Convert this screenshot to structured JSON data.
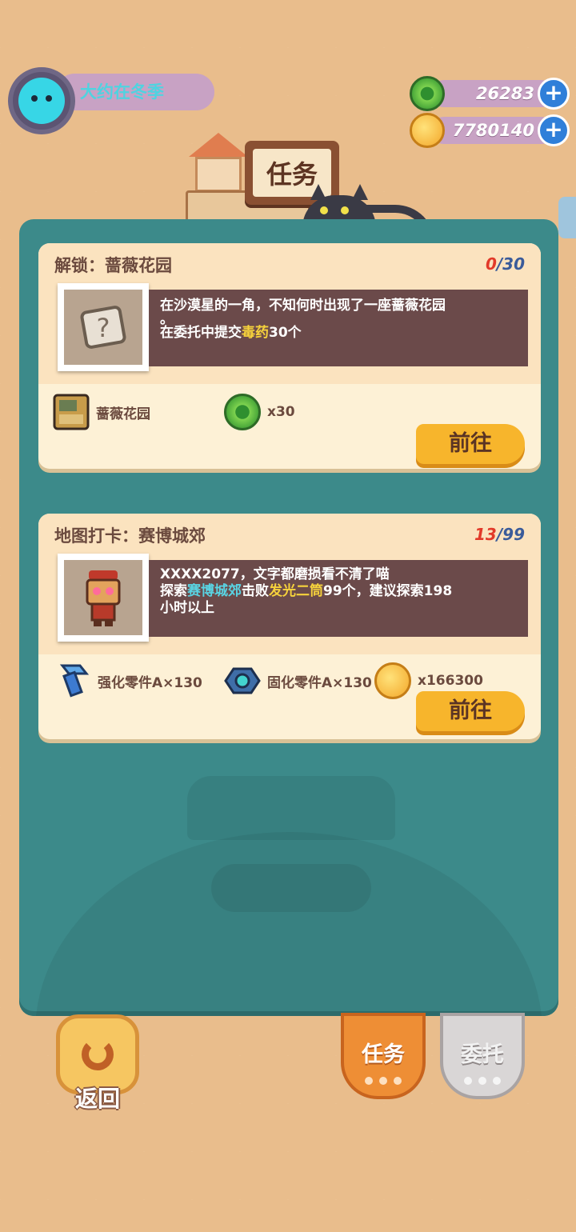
{
  "player": {
    "name": "大约在冬季"
  },
  "currency": [
    {
      "icon": "green-coin-icon",
      "value": "26283"
    },
    {
      "icon": "gold-coin-icon",
      "value": "7780140"
    }
  ],
  "header": {
    "title": "任务"
  },
  "quests": [
    {
      "title": "解锁：蔷薇花园",
      "progress_current": "0",
      "progress_total": "/30",
      "image_icon": "unknown-map-icon",
      "desc_line1": "在沙漠星的一角，不知何时出现了一座蔷薇花园",
      "desc_line2_prefix": "。",
      "desc_line3_prefix": "在委托中提交",
      "desc_highlight1": "毒药",
      "desc_line3_suffix": "30个",
      "rewards": [
        {
          "icon": "garden-map-icon",
          "label": "蔷薇花园"
        },
        {
          "icon": "green-coin-icon",
          "label": "x30"
        }
      ],
      "button": "前往"
    },
    {
      "title": "地图打卡：赛博城郊",
      "progress_current": "13",
      "progress_total": "/99",
      "image_icon": "robot-icon",
      "desc_line1": "XXXX2077，文字都磨损看不清了喵",
      "desc_line2_prefix": "探索",
      "desc_highlight_cyan": "赛博城郊",
      "desc_mid": "击败",
      "desc_highlight_yellow": "发光二筒",
      "desc_line2_suffix": "99个，建议探索198",
      "desc_line3": "小时以上",
      "rewards": [
        {
          "icon": "bolt-icon",
          "label": "强化零件A×130"
        },
        {
          "icon": "hex-nut-icon",
          "label": "固化零件A×130"
        },
        {
          "icon": "gold-coin-icon",
          "label": "x166300"
        }
      ],
      "button": "前往"
    }
  ],
  "bottom": {
    "back_label": "返回",
    "tab_task": "任务",
    "tab_entrust": "委托"
  }
}
